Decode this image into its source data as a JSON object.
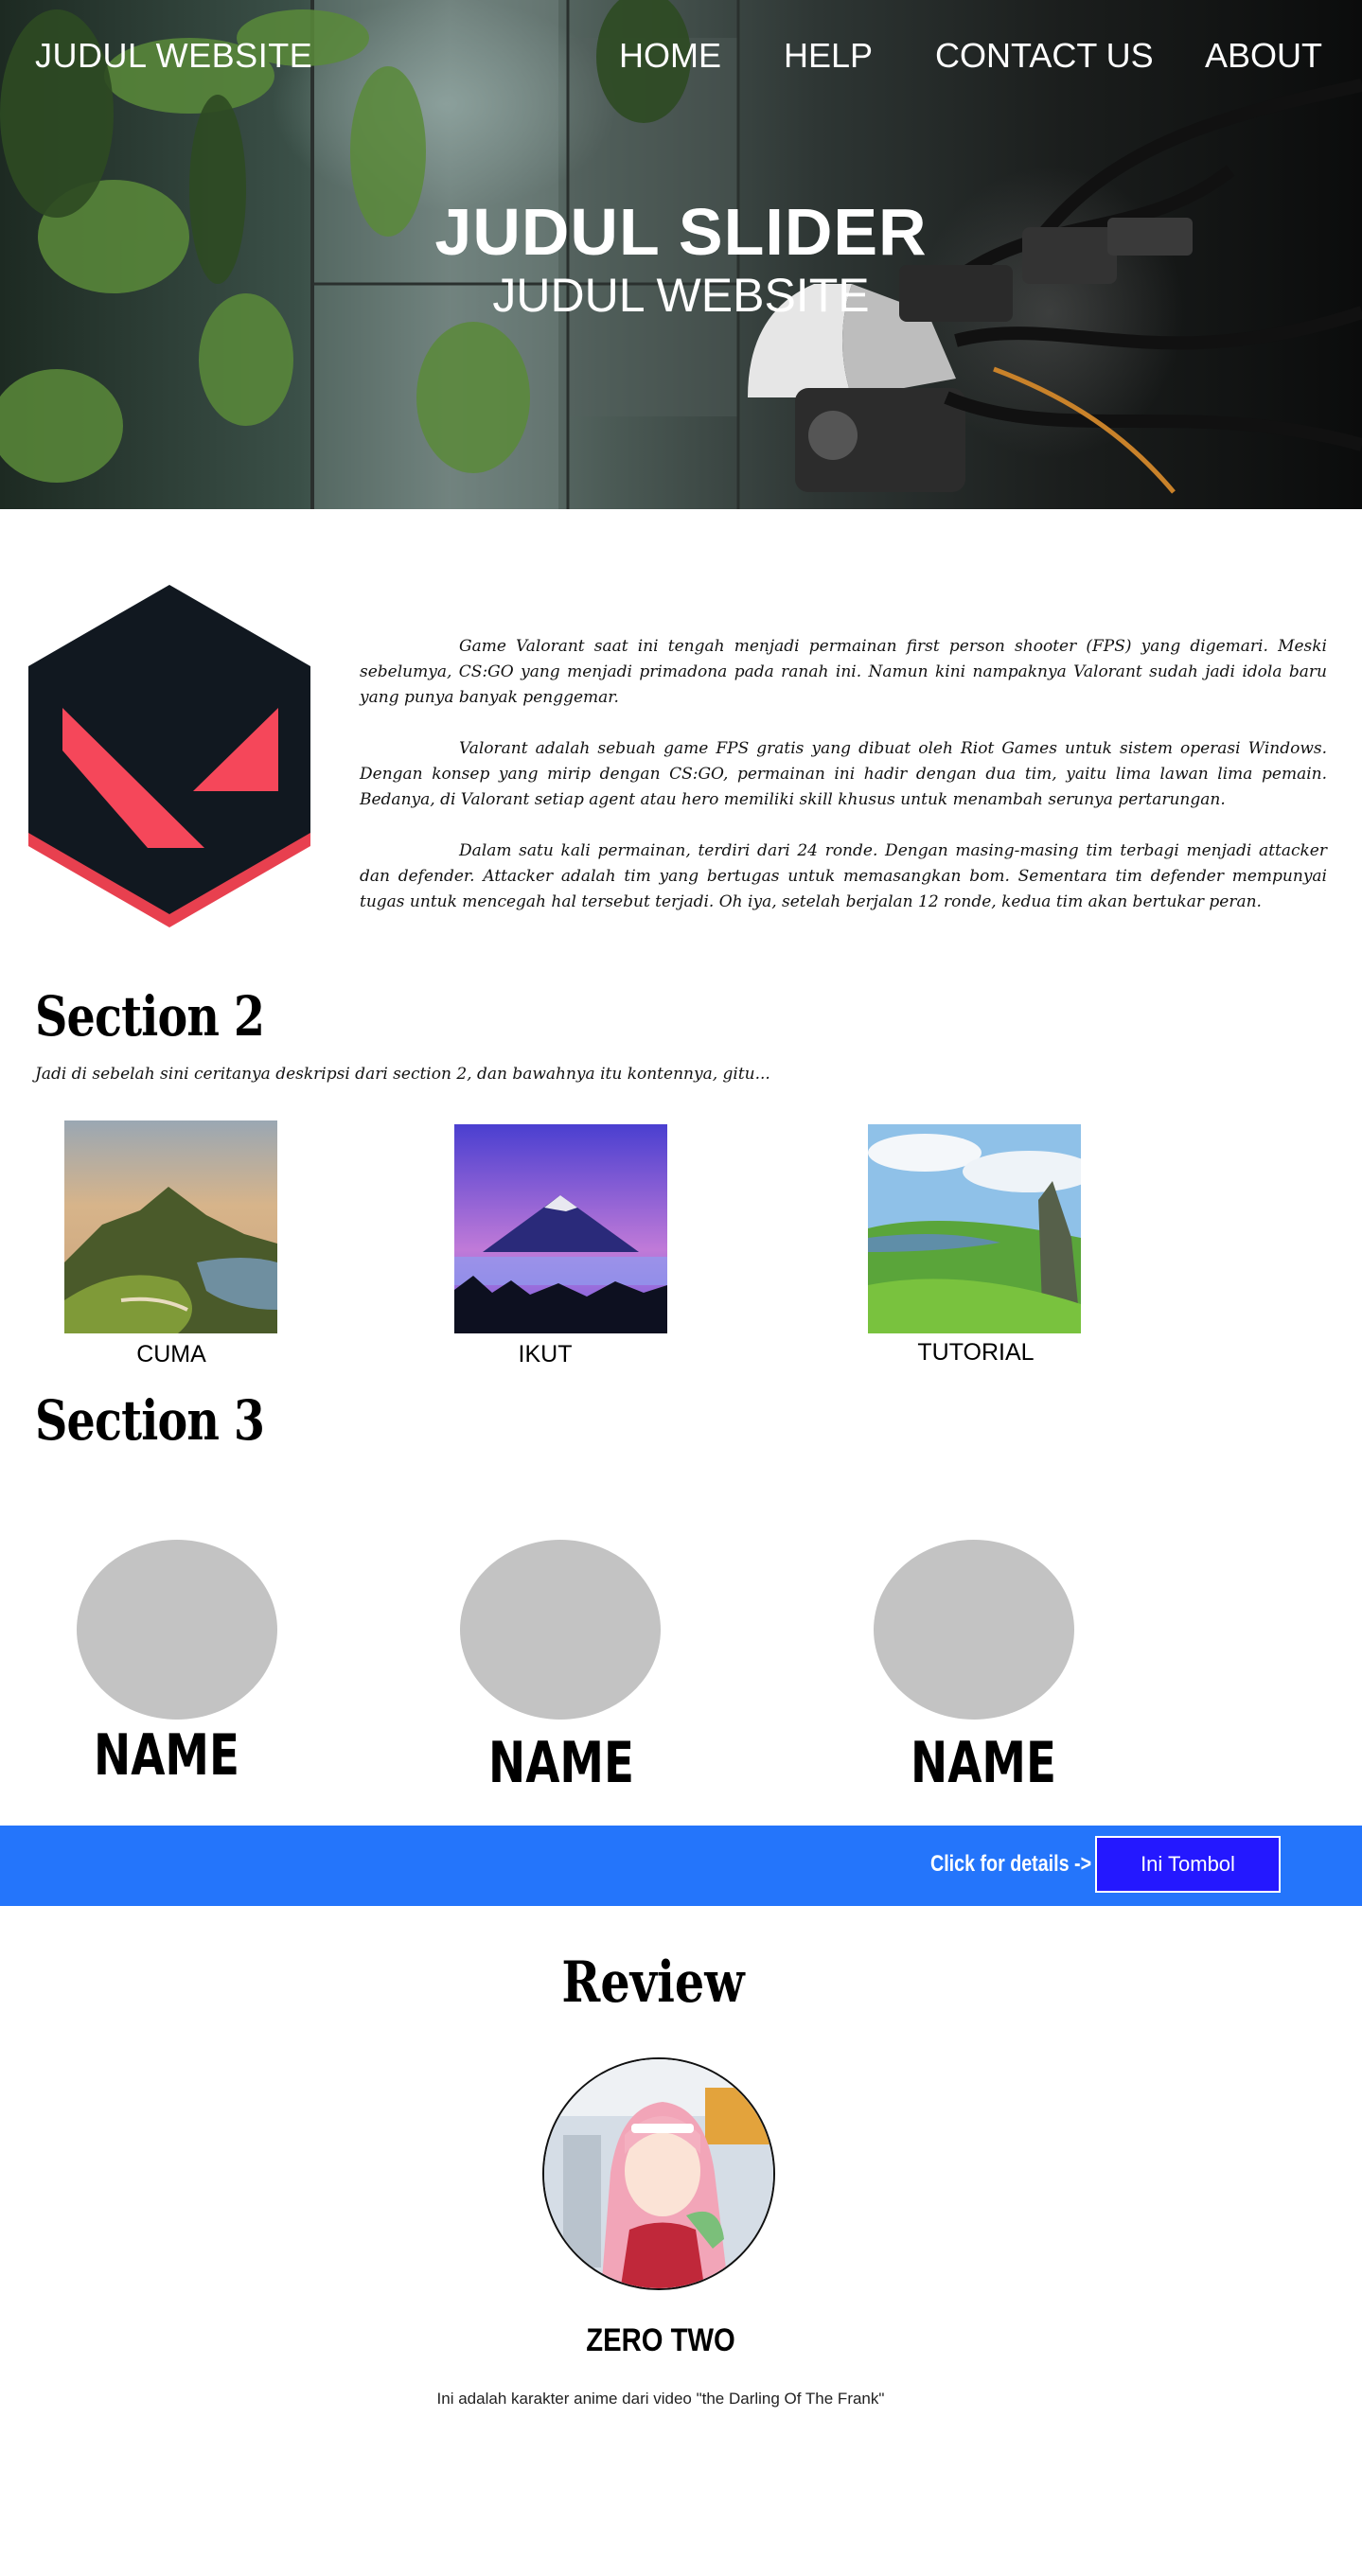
{
  "header": {
    "brand": "JUDUL WEBSITE",
    "nav": [
      "HOME",
      "HELP",
      "CONTACT US",
      "ABOUT"
    ]
  },
  "hero": {
    "title": "JUDUL SLIDER",
    "subtitle": "JUDUL WEBSITE"
  },
  "about": {
    "logo_icon": "valorant-logo-icon",
    "paragraphs": [
      "Game Valorant saat ini tengah menjadi permainan first person shooter (FPS) yang digemari. Meski sebelumya, CS:GO yang menjadi primadona pada ranah ini. Namun kini nampaknya Valorant sudah jadi idola baru yang punya banyak penggemar.",
      "Valorant adalah sebuah game FPS gratis yang dibuat oleh Riot Games untuk sistem operasi Windows. Dengan konsep yang mirip dengan CS:GO, permainan ini hadir dengan dua tim, yaitu lima lawan lima pemain. Bedanya, di Valorant setiap agent atau hero memiliki skill khusus untuk menambah serunya pertarungan.",
      "Dalam satu kali permainan, terdiri dari 24 ronde. Dengan masing-masing tim terbagi menjadi attacker dan defender. Attacker adalah tim yang bertugas untuk memasangkan bom. Sementara tim defender mempunyai tugas untuk mencegah hal tersebut terjadi. Oh iya, setelah berjalan 12 ronde, kedua tim akan bertukar peran."
    ]
  },
  "section2": {
    "title": "Section 2",
    "description": "Jadi di sebelah sini ceritanya deskripsi dari section 2, dan bawahnya itu kontennya, gitu...",
    "items": [
      {
        "label": "CUMA"
      },
      {
        "label": "IKUT"
      },
      {
        "label": "TUTORIAL"
      }
    ]
  },
  "section3": {
    "title": "Section 3",
    "members": [
      {
        "name": "NAME"
      },
      {
        "name": "NAME"
      },
      {
        "name": "NAME"
      }
    ]
  },
  "cta": {
    "text": "Click for details  ->",
    "button_label": "Ini Tombol",
    "bar_color": "#2475fb",
    "button_color": "#2418ff"
  },
  "review": {
    "title": "Review",
    "name": "ZERO TWO",
    "caption": "Ini adalah karakter anime dari video \"the Darling Of The Frank\""
  }
}
